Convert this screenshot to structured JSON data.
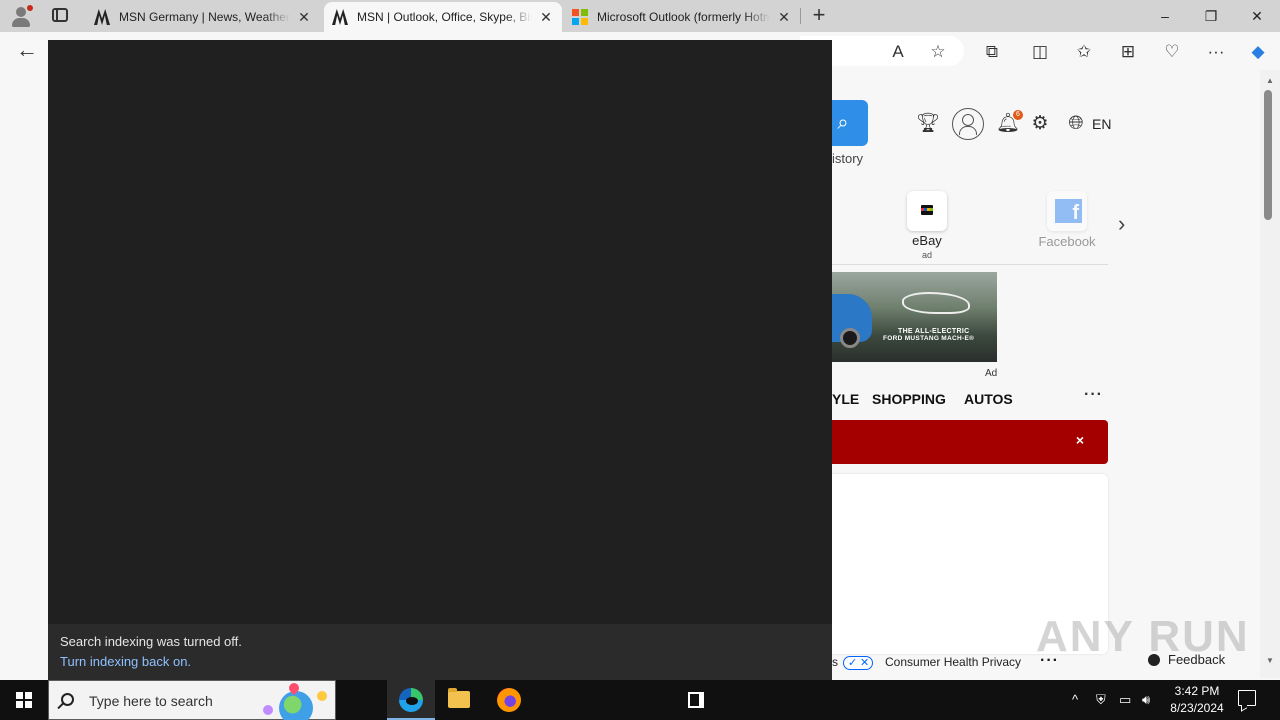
{
  "browser": {
    "tabs": [
      {
        "title": "MSN Germany | News, Weather, Sports",
        "favicon": "msn-icon",
        "active": false
      },
      {
        "title": "MSN | Outlook, Office, Skype, Bing",
        "favicon": "msn-icon",
        "active": true
      },
      {
        "title": "Microsoft Outlook (formerly Hotmail)",
        "favicon": "microsoft-icon",
        "active": false
      }
    ],
    "new_tab": "+",
    "window_controls": {
      "minimize": "–",
      "restore": "❐",
      "close": "✕"
    },
    "tab_close": "✕"
  },
  "toolbar": {
    "back": "←",
    "read_aloud": "A",
    "favorite": "☆",
    "extensions": "⧉",
    "split_screen": "◫",
    "favorites": "✩",
    "collections": "⊞",
    "browser_essentials": "♡",
    "more": "···",
    "copilot": "◆"
  },
  "msn": {
    "search_history_partial": "istory",
    "notification_count": "6",
    "language": "EN",
    "tiles": [
      {
        "label": "eBay",
        "ad": "ad"
      },
      {
        "label": "Facebook"
      }
    ],
    "ad": {
      "line1": "THE ALL-ELECTRIC",
      "line2": "FORD MUSTANG MACH-E®",
      "label": "Ad"
    },
    "nav": [
      "YLE",
      "SHOPPING",
      "AUTOS"
    ],
    "nav_more": "···",
    "banner_close": "×",
    "footer": {
      "partial": "s",
      "privacy": "Consumer Health Privacy",
      "more": "···",
      "feedback": "Feedback"
    },
    "watermark": "ANY RUN"
  },
  "search_flyout": {
    "message": "Search indexing was turned off.",
    "link": "Turn indexing back on."
  },
  "taskbar": {
    "search_placeholder": "Type here to search",
    "tray_chevron": "^",
    "time": "3:42 PM",
    "date": "8/23/2024"
  },
  "colors": {
    "flyout_bg": "#202020",
    "link": "#8fc0ff",
    "msn_search": "#2f8fe8",
    "banner_red": "#a50000"
  }
}
